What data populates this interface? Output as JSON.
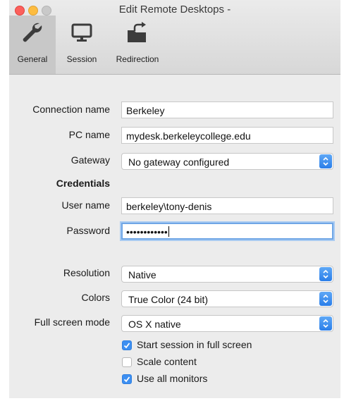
{
  "window": {
    "title": "Edit Remote Desktops -"
  },
  "toolbar": {
    "tabs": [
      {
        "label": "General",
        "icon": "wrench-icon",
        "active": true
      },
      {
        "label": "Session",
        "icon": "monitor-icon",
        "active": false
      },
      {
        "label": "Redirection",
        "icon": "folder-redirect-icon",
        "active": false
      }
    ]
  },
  "form": {
    "connection_name": {
      "label": "Connection name",
      "value": "Berkeley"
    },
    "pc_name": {
      "label": "PC name",
      "value": "mydesk.berkeleycollege.edu"
    },
    "gateway": {
      "label": "Gateway",
      "value": "No gateway configured"
    },
    "credentials_heading": "Credentials",
    "user_name": {
      "label": "User name",
      "value": "berkeley\\tony-denis"
    },
    "password": {
      "label": "Password",
      "value": "••••••••••••"
    },
    "resolution": {
      "label": "Resolution",
      "value": "Native"
    },
    "colors": {
      "label": "Colors",
      "value": "True Color (24 bit)"
    },
    "full_screen_mode": {
      "label": "Full screen mode",
      "value": "OS X native"
    },
    "options": [
      {
        "label": "Start session in full screen",
        "checked": true
      },
      {
        "label": "Scale content",
        "checked": false
      },
      {
        "label": "Use all monitors",
        "checked": true
      }
    ]
  },
  "colors": {
    "accent": "#3d8ff1",
    "focus_ring": "#6fa6e6"
  }
}
